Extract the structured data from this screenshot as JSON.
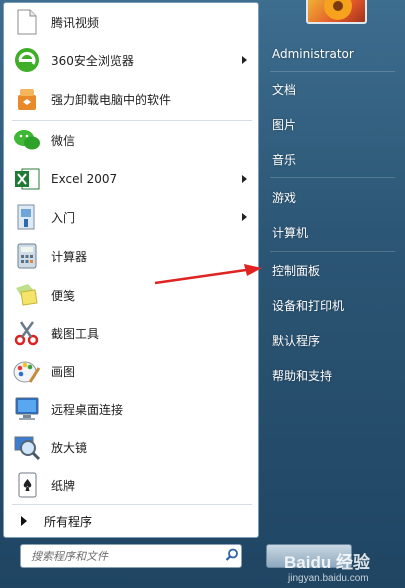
{
  "programs": [
    {
      "label": "腾讯视频",
      "has_arrow": false,
      "icon": "tencent-video-icon"
    },
    {
      "label": "360安全浏览器",
      "has_arrow": true,
      "icon": "360-browser-icon"
    },
    {
      "label": "强力卸载电脑中的软件",
      "has_arrow": false,
      "icon": "uninstaller-icon"
    },
    {
      "label": "微信",
      "has_arrow": false,
      "icon": "wechat-icon"
    },
    {
      "label": "Excel 2007",
      "has_arrow": true,
      "icon": "excel-icon"
    },
    {
      "label": "入门",
      "has_arrow": true,
      "icon": "getting-started-icon"
    },
    {
      "label": "计算器",
      "has_arrow": false,
      "icon": "calculator-icon"
    },
    {
      "label": "便笺",
      "has_arrow": false,
      "icon": "sticky-notes-icon"
    },
    {
      "label": "截图工具",
      "has_arrow": false,
      "icon": "snipping-tool-icon"
    },
    {
      "label": "画图",
      "has_arrow": false,
      "icon": "paint-icon"
    },
    {
      "label": "远程桌面连接",
      "has_arrow": false,
      "icon": "remote-desktop-icon"
    },
    {
      "label": "放大镜",
      "has_arrow": false,
      "icon": "magnifier-icon"
    },
    {
      "label": "纸牌",
      "has_arrow": false,
      "icon": "solitaire-icon"
    }
  ],
  "all_programs": "所有程序",
  "search": {
    "placeholder": "搜索程序和文件"
  },
  "right_links": [
    {
      "label": "Administrator"
    },
    {
      "label": "文档"
    },
    {
      "label": "图片"
    },
    {
      "label": "音乐"
    },
    {
      "label": "游戏"
    },
    {
      "label": "计算机"
    },
    {
      "label": "控制面板"
    },
    {
      "label": "设备和打印机"
    },
    {
      "label": "默认程序"
    },
    {
      "label": "帮助和支持"
    }
  ],
  "watermark": {
    "brand": "Baidu 经验",
    "url": "jingyan.baidu.com"
  },
  "colors": {
    "arrow": "#e02424",
    "menu_bg": "#2c5675",
    "panel_bg": "#ffffff"
  }
}
